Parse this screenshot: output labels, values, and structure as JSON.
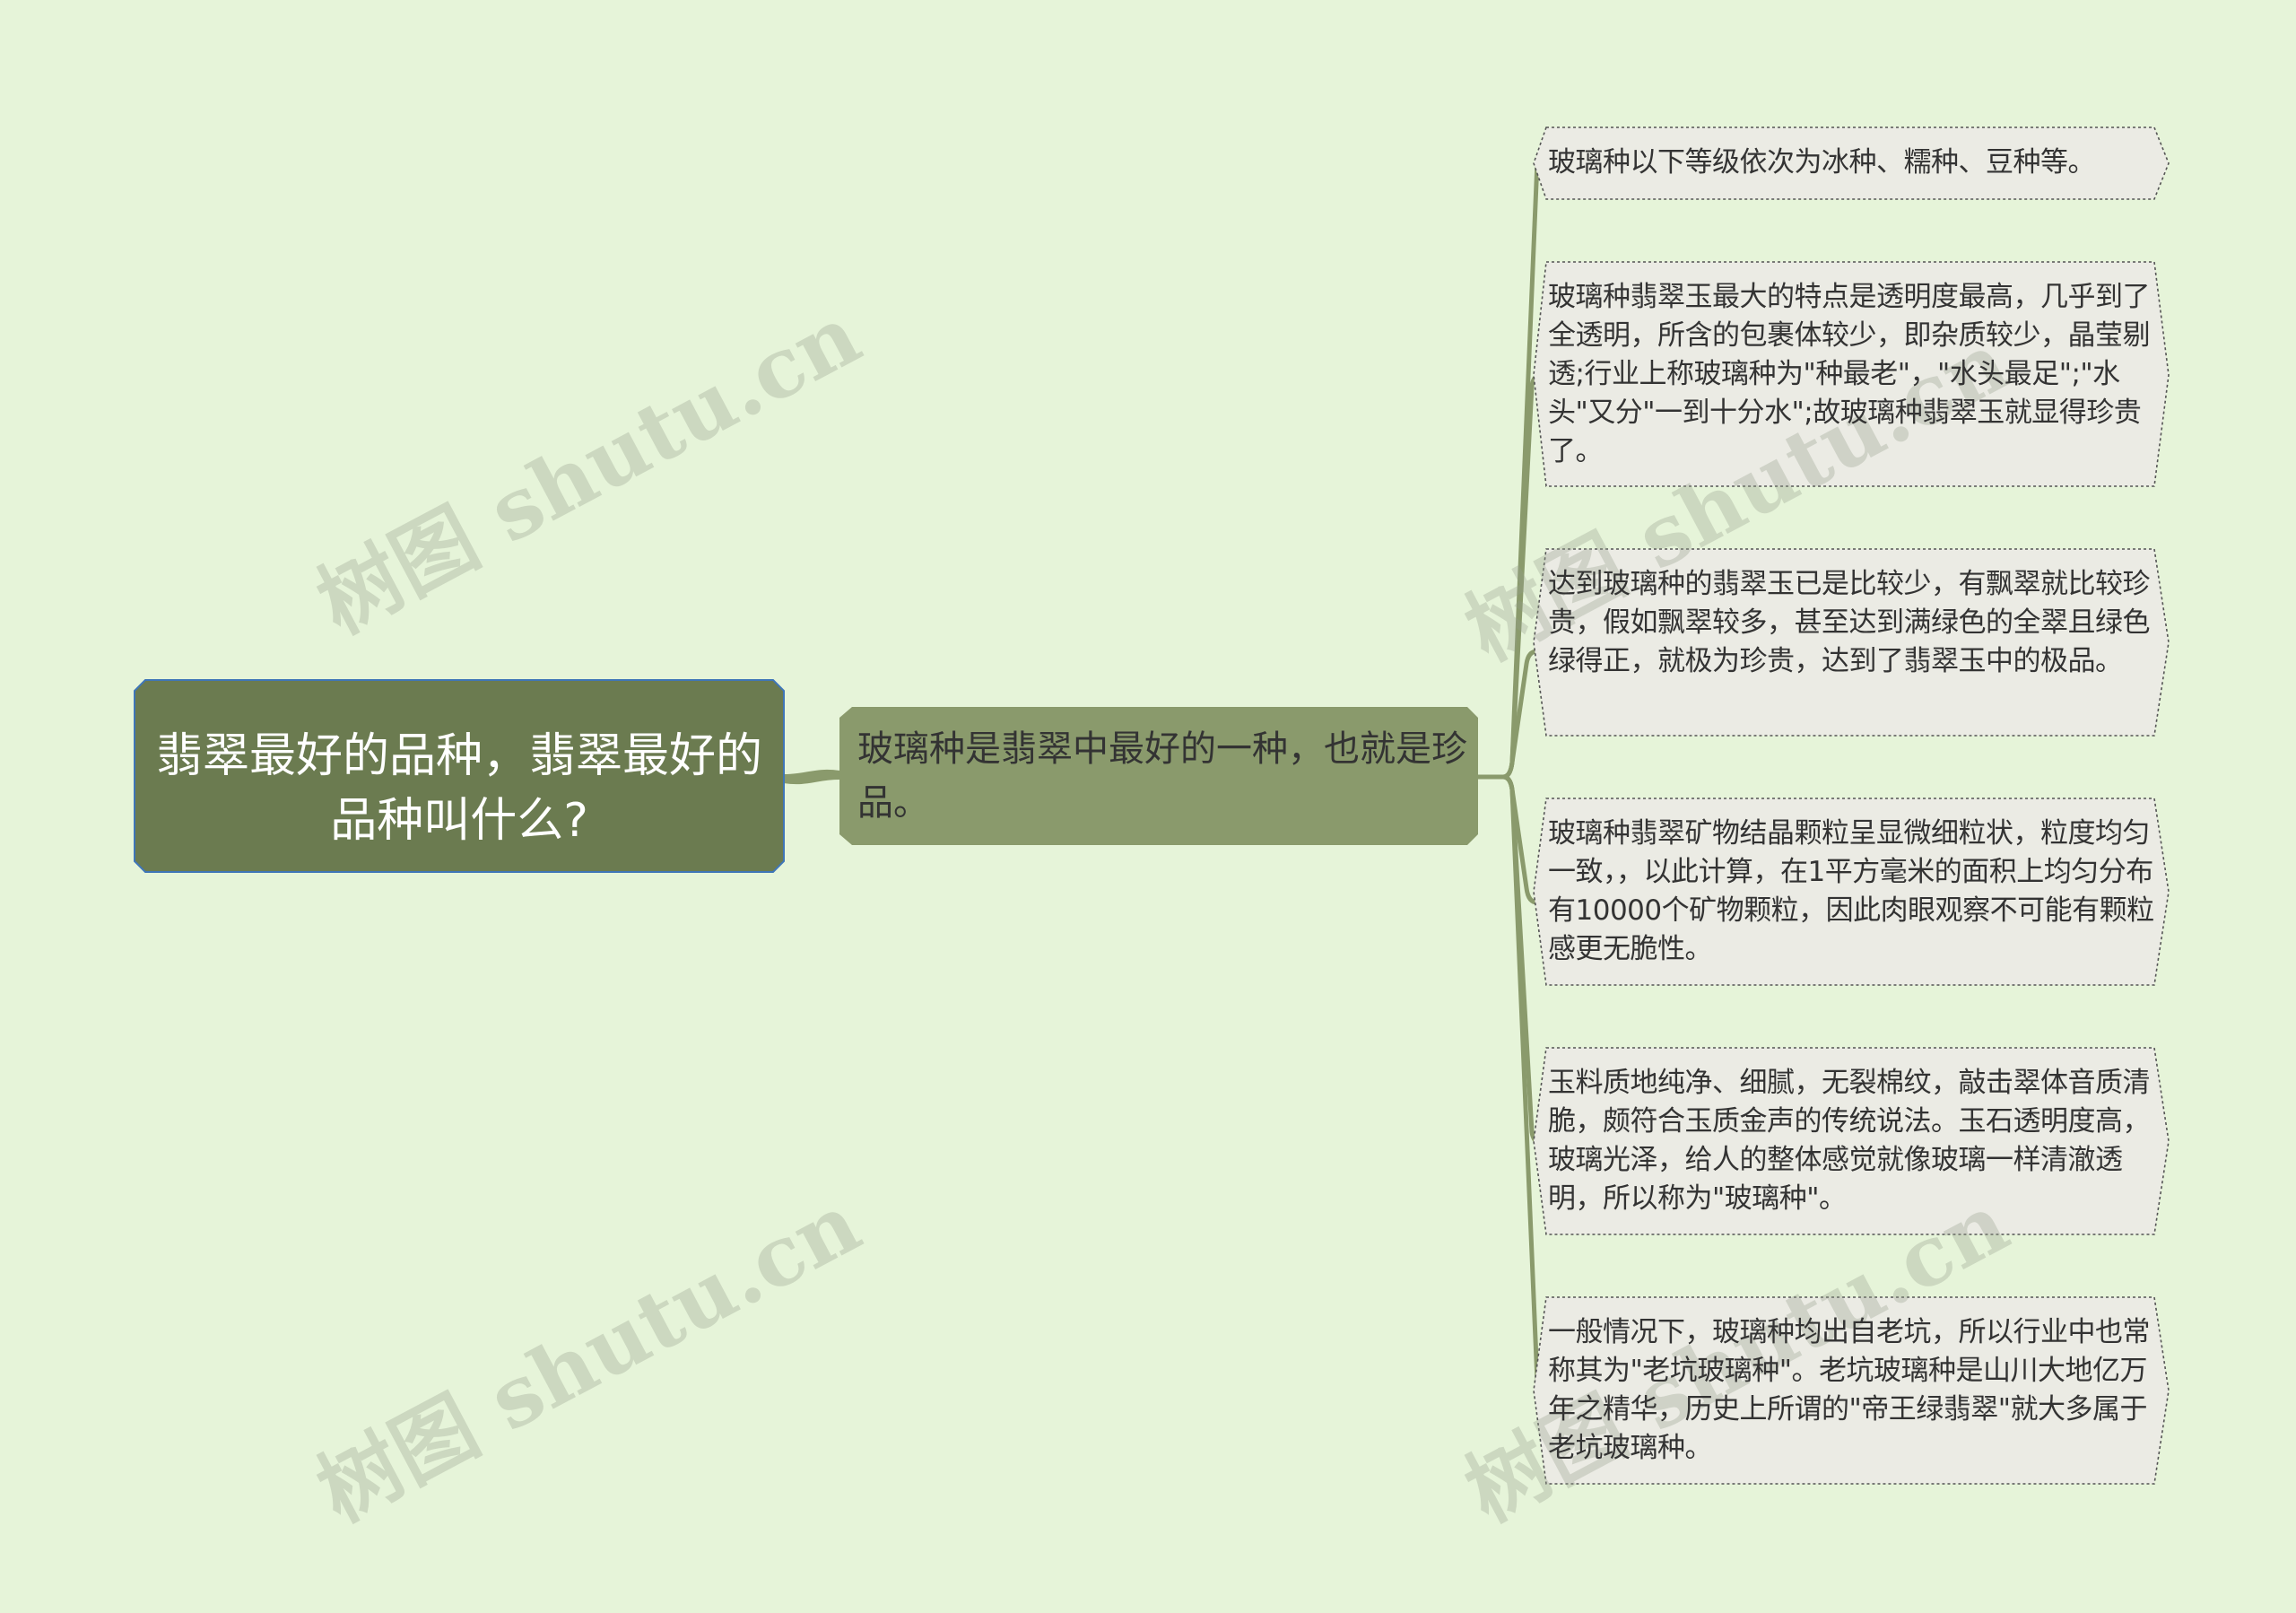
{
  "root": {
    "text": "翡翠最好的品种，翡翠最好的品种叫什么?"
  },
  "main": {
    "text": "玻璃种是翡翠中最好的一种，也就是珍品。"
  },
  "leaves": [
    "玻璃种以下等级依次为冰种、糯种、豆种等。",
    "玻璃种翡翠玉最大的特点是透明度最高，几乎到了全透明，所含的包裹体较少，即杂质较少，晶莹剔透;行业上称玻璃种为\"种最老\"，\"水头最足\";\"水头\"又分\"一到十分水\";故玻璃种翡翠玉就显得珍贵了。",
    "达到玻璃种的翡翠玉已是比较少，有飘翠就比较珍贵，假如飘翠较多，甚至达到满绿色的全翠且绿色绿得正，就极为珍贵，达到了翡翠玉中的极品。",
    "玻璃种翡翠矿物结晶颗粒呈显微细粒状，粒度均匀一致，，以此计算，在1平方毫米的面积上均匀分布有10000个矿物颗粒，因此肉眼观察不可能有颗粒感更无脆性。",
    "玉料质地纯净、细腻，无裂棉纹，敲击翠体音质清脆，颇符合玉质金声的传统说法。玉石透明度高，玻璃光泽，给人的整体感觉就像玻璃一样清澈透明，所以称为\"玻璃种\"。",
    "一般情况下，玻璃种均出自老坑，所以行业中也常称其为\"老坑玻璃种\"。老坑玻璃种是山川大地亿万年之精华，历史上所谓的\"帝王绿翡翠\"就大多属于老坑玻璃种。"
  ],
  "watermark": "树图 shutu.cn",
  "colors": {
    "background": "#e6f4d9",
    "root_fill": "#6b7b50",
    "root_stroke": "#3f76b8",
    "main_fill": "#8a9a6c",
    "leaf_fill": "#ebebe4",
    "connector": "#8a9a6c"
  }
}
